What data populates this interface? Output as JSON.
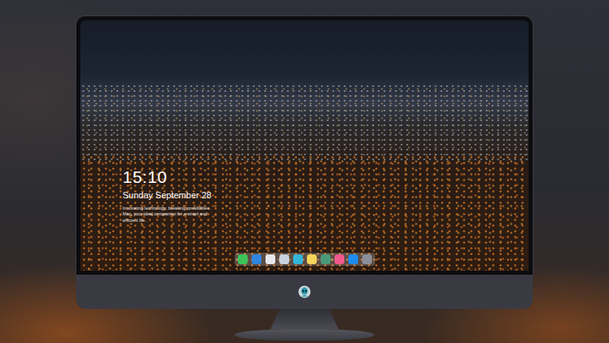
{
  "desktop": {
    "clock": "15:10",
    "date": "Sunday September 28",
    "tagline": "Innovating technology, breaking possibilities. Mac, your ideal companion for a smart and efficient life."
  },
  "dock": {
    "items": [
      {
        "color": "#3cc45a"
      },
      {
        "color": "#2f86e0"
      },
      {
        "color": "#e8e8ea"
      },
      {
        "color": "#c9d3df"
      },
      {
        "color": "#35b6d8"
      },
      {
        "color": "#f5d45a"
      },
      {
        "color": "#4a9a7a"
      },
      {
        "color": "#f05a8c"
      },
      {
        "color": "#1d8cf0"
      },
      {
        "color": "#8a8f99"
      }
    ]
  }
}
